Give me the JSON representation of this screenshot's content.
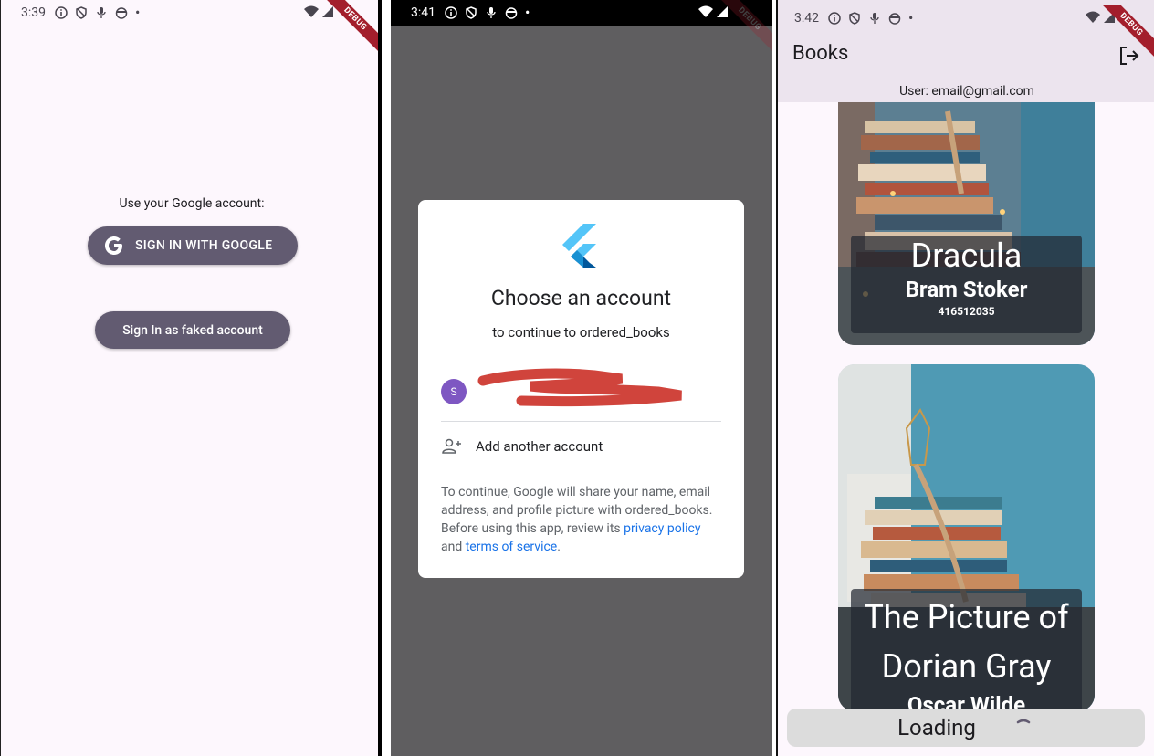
{
  "panel1": {
    "status_time": "3:39",
    "debug": "DEBUG",
    "prompt": "Use your Google account:",
    "google_button": "SIGN IN WITH GOOGLE",
    "fake_button": "Sign In as faked account"
  },
  "panel2": {
    "status_time": "3:41",
    "debug": "DEBUG",
    "title": "Choose an account",
    "subtitle": "to continue to ordered_books",
    "account_initial": "S",
    "add_account": "Add another account",
    "legal_prefix": "To continue, Google will share your name, email address, and profile picture with ordered_books. Before using this app, review its ",
    "privacy_link": "privacy policy",
    "legal_and": " and ",
    "terms_link": "terms of service",
    "legal_end": "."
  },
  "panel3": {
    "status_time": "3:42",
    "debug": "DEBUG",
    "title": "Books",
    "user_line": "User: email@gmail.com",
    "books": [
      {
        "title": "Dracula",
        "author": "Bram Stoker",
        "isbn": "416512035"
      },
      {
        "title": "The Picture of Dorian Gray",
        "author": "Oscar Wilde"
      }
    ],
    "loading": "Loading"
  }
}
